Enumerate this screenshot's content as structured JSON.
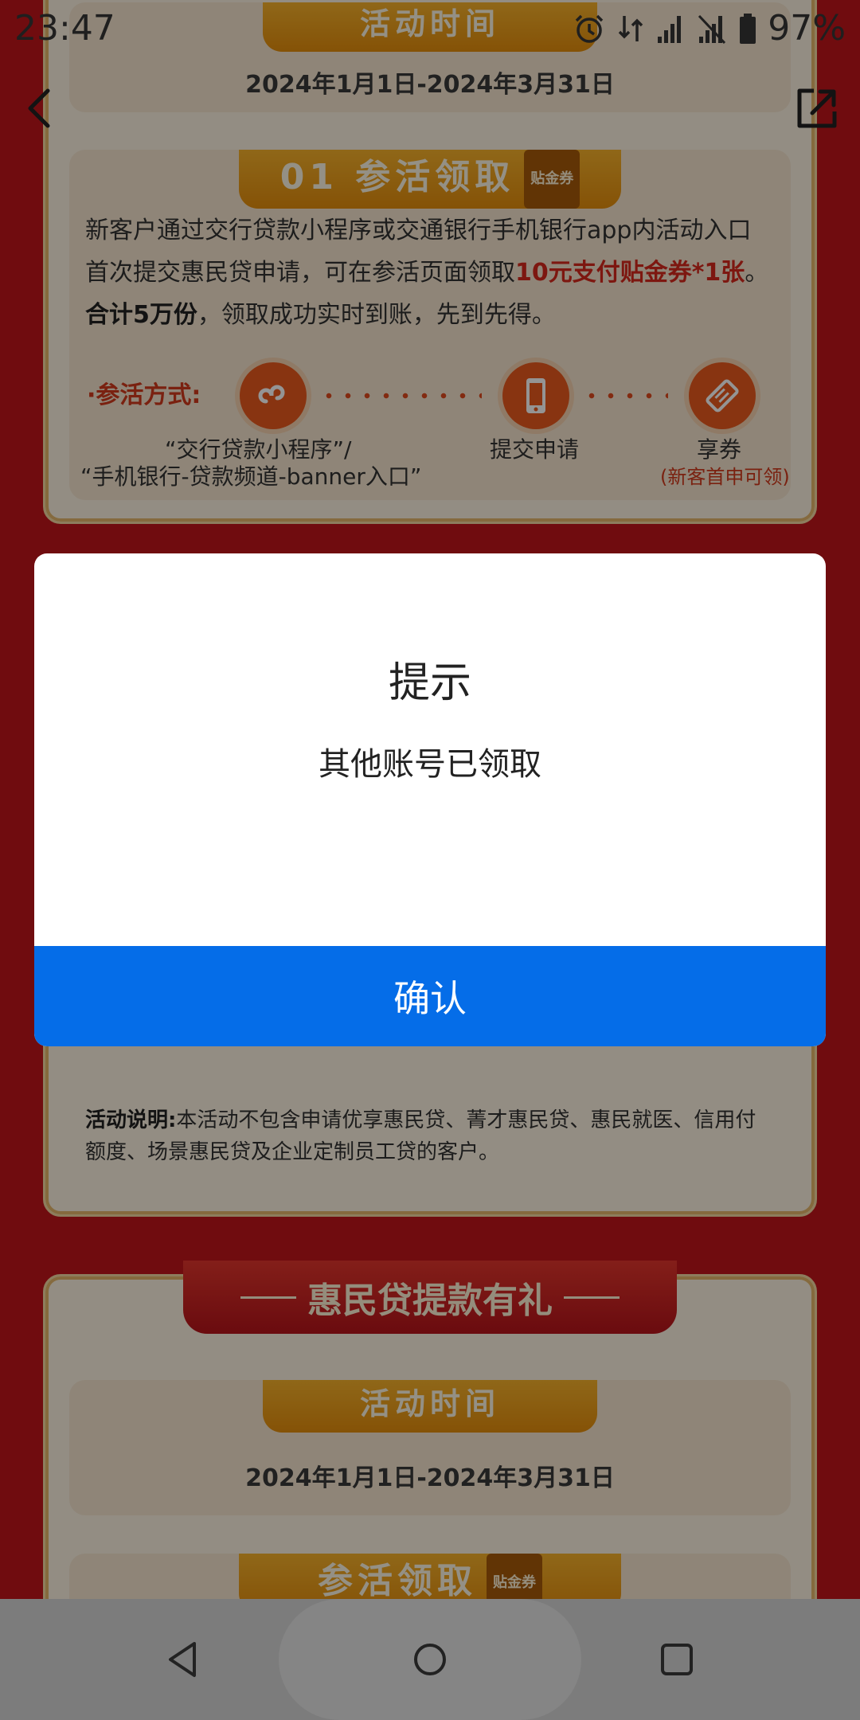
{
  "status_bar": {
    "time": "23:47",
    "battery": "97%",
    "icons": [
      "alarm-icon",
      "data-arrows-icon",
      "signal-icon",
      "signal-no-service-icon",
      "battery-icon"
    ]
  },
  "top_nav": {
    "back_icon": "chevron-left-icon",
    "share_icon": "share-external-icon"
  },
  "background": {
    "section1": {
      "time_ribbon": "活动时间",
      "time_range": "2024年1月1日-2024年3月31日",
      "step_ribbon": "01 参活领取",
      "step_tag": "贴金券",
      "description_part1": "新客户通过交行贷款小程序或交通银行手机银行app内活动入口首次提交惠民贷申请，可在参活页面领取",
      "description_highlight": "10元支付贴金券*1张",
      "description_part2": "。",
      "description_bold": "合计5万份",
      "description_part3": "，领取成功实时到账，先到先得。",
      "steps_label": "·参活方式:",
      "step1_line1": "“交行贷款小程序”/",
      "step1_line2": "“手机银行-贷款频道-banner入口”",
      "step2": "提交申请",
      "step3": "享券",
      "step3_sub": "(新客首申可领)"
    },
    "note_label": "活动说明:",
    "note_text": "本活动不包含申请优享惠民贷、菁才惠民贷、惠民就医、信用付额度、场景惠民贷及企业定制员工贷的客户。",
    "section2": {
      "banner": "惠民贷提款有礼",
      "time_ribbon": "活动时间",
      "time_range": "2024年1月1日-2024年3月31日",
      "step_ribbon": "参活领取",
      "step_tag": "贴金券"
    }
  },
  "dialog": {
    "title": "提示",
    "message": "其他账号已领取",
    "confirm_label": "确认",
    "button_color": "#056de8"
  },
  "system_nav": {
    "back_icon": "triangle-back-icon",
    "home_icon": "circle-home-icon",
    "recents_icon": "square-recents-icon"
  }
}
